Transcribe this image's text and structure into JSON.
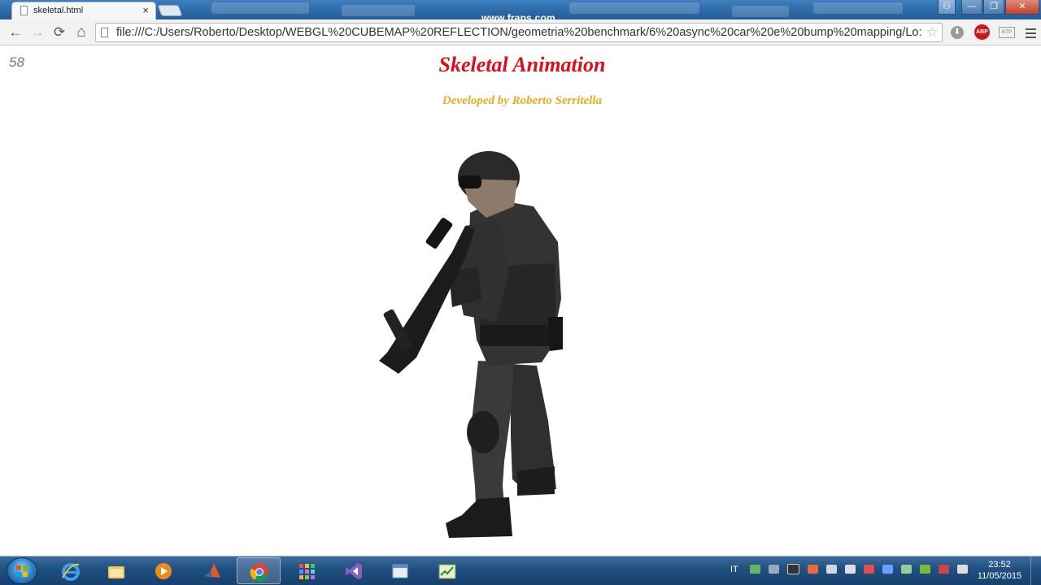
{
  "browser": {
    "tab_title": "skeletal.html",
    "tab_close": "×",
    "url": "file:///C:/Users/Roberto/Desktop/WEBGL%20CUBEMAP%20REFLECTION/geometria%20benchmark/6%20async%20car%20e%20bump%20mapping/Lo:",
    "overlay_watermark": "www.fraps.com",
    "nav": {
      "back": "←",
      "forward": "→",
      "reload": "⟳",
      "home": "⌂",
      "star": "☆"
    },
    "extensions": {
      "download": "⬇",
      "adblock": "ABP",
      "ntp": "NTP"
    },
    "window_buttons": {
      "user": "⚇",
      "minimize": "—",
      "maximize": "❐",
      "close": "✕"
    }
  },
  "page": {
    "fps_counter": "58",
    "title": "Skeletal Animation",
    "credit": "Developed by Roberto Serritella",
    "scene_subject": "soldier-model"
  },
  "taskbar": {
    "apps": [
      {
        "name": "internet-explorer-icon"
      },
      {
        "name": "file-explorer-icon"
      },
      {
        "name": "media-player-icon"
      },
      {
        "name": "matlab-icon"
      },
      {
        "name": "chrome-icon",
        "active": true
      },
      {
        "name": "apps-grid-icon"
      },
      {
        "name": "visual-studio-icon"
      },
      {
        "name": "window-app-icon"
      },
      {
        "name": "task-manager-icon"
      }
    ],
    "tray_lang": "IT",
    "clock_time": "23:52",
    "clock_date": "11/05/2015"
  },
  "colors": {
    "title": "#e00b1b",
    "credit": "#f0ab1c",
    "fps": "#777777"
  }
}
